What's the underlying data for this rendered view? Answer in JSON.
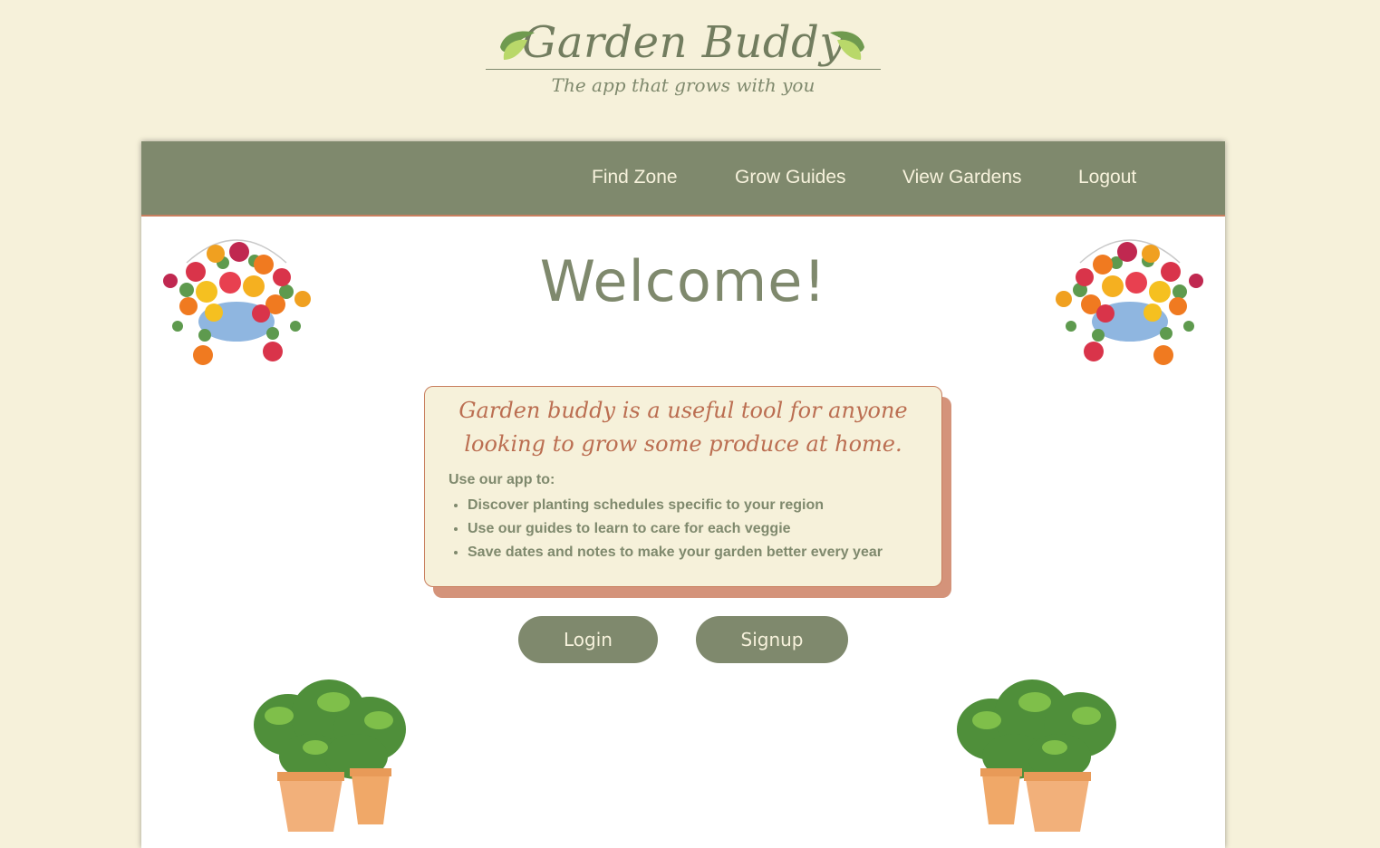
{
  "brand": {
    "title": "Garden Buddy",
    "tagline": "The app that grows with you",
    "logo_icon": "leaf-icon"
  },
  "nav": {
    "items": [
      {
        "label": "Find Zone"
      },
      {
        "label": "Grow Guides"
      },
      {
        "label": "View Gardens"
      },
      {
        "label": "Logout"
      }
    ]
  },
  "main": {
    "heading": "Welcome!",
    "info": {
      "heading": "Garden buddy is a useful tool for anyone looking to grow some produce at home.",
      "intro": "Use our app to:",
      "bullets": [
        "Discover planting schedules specific to your region",
        "Use our guides to learn to care for each veggie",
        "Save dates and notes to make your garden better every year"
      ]
    },
    "buttons": {
      "login": "Login",
      "signup": "Signup"
    }
  },
  "colors": {
    "background": "#f6f1da",
    "sage": "#7f896d",
    "terracotta": "#c87f5f",
    "cream": "#f7f2dc"
  }
}
